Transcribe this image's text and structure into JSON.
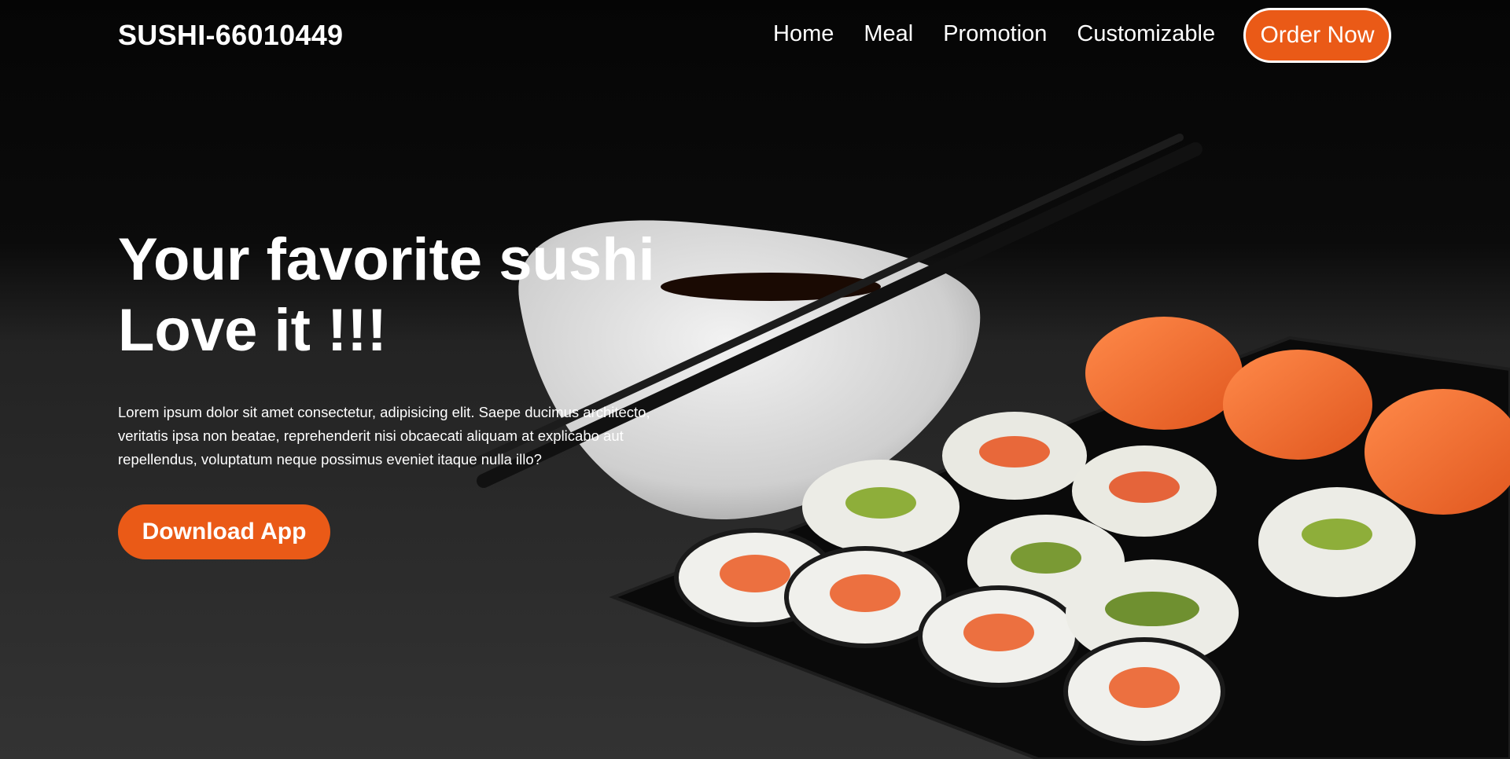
{
  "brand": "SUSHI-66010449",
  "nav": {
    "links": [
      "Home",
      "Meal",
      "Promotion",
      "Customizable"
    ],
    "cta": "Order Now"
  },
  "hero": {
    "title_line1": "Your favorite sushi",
    "title_line2": "Love it !!!",
    "description": "Lorem ipsum dolor sit amet consectetur, adipisicing elit. Saepe ducimus architecto, veritatis ipsa non beatae, reprehenderit nisi obcaecati aliquam at explicabo aut repellendus, voluptatum neque possimus eveniet itaque nulla illo?",
    "button": "Download App"
  },
  "colors": {
    "accent": "#ea5a17",
    "background": "#000000",
    "text": "#ffffff"
  }
}
